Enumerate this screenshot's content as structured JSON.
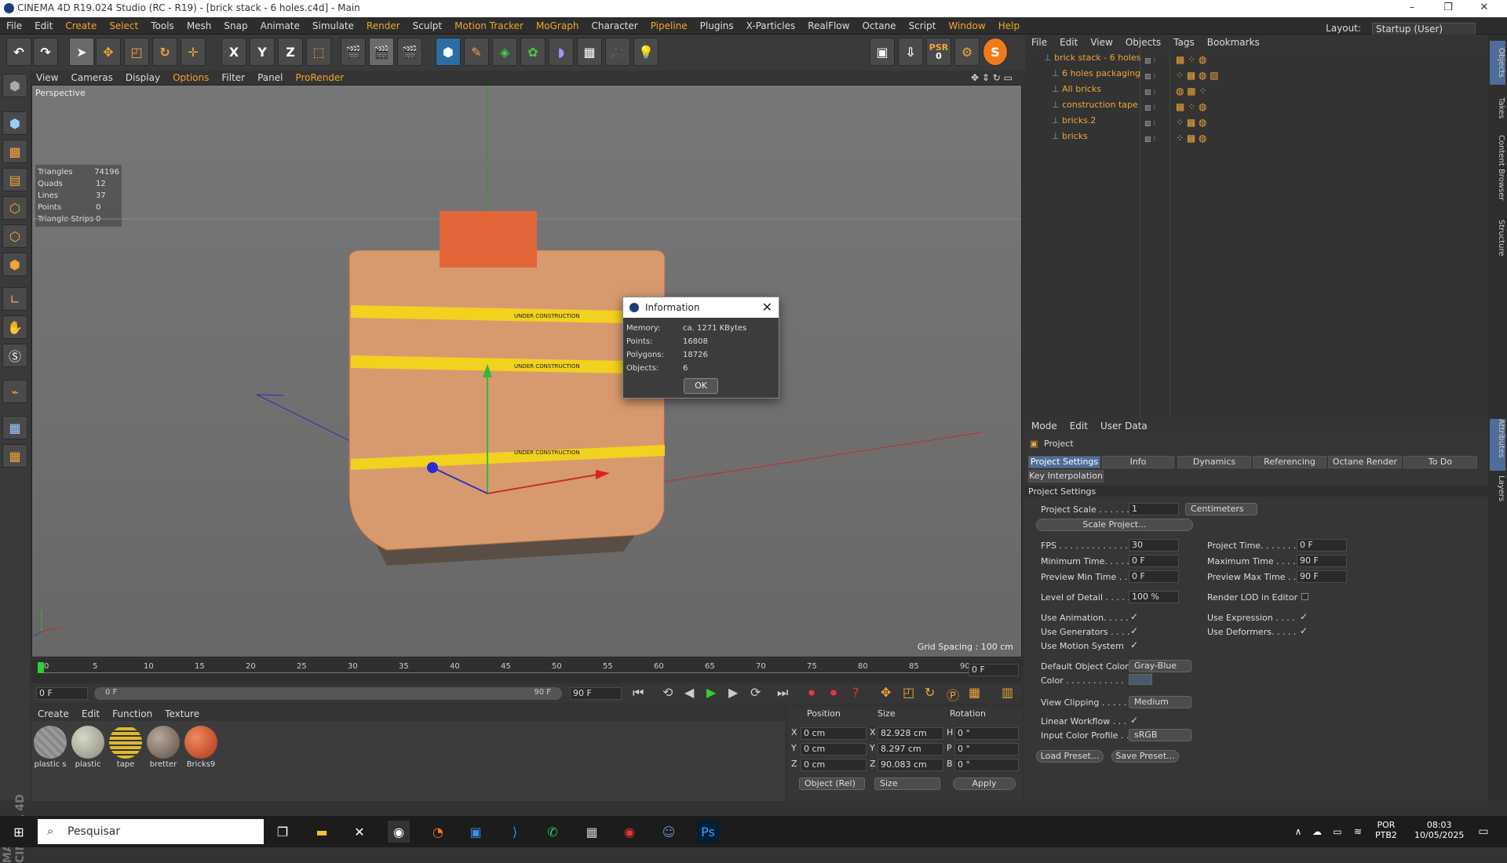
{
  "window": {
    "title": "CINEMA 4D R19.024 Studio (RC - R19) - [brick stack - 6 holes.c4d] - Main"
  },
  "menubar": {
    "items": [
      "File",
      "Edit",
      "Create",
      "Select",
      "Tools",
      "Mesh",
      "Snap",
      "Animate",
      "Simulate",
      "Render",
      "Sculpt",
      "Motion Tracker",
      "MoGraph",
      "Character",
      "Pipeline",
      "Plugins",
      "X-Particles",
      "RealFlow",
      "Octane",
      "Script",
      "Window",
      "Help"
    ],
    "layout_label": "Layout:",
    "layout_value": "Startup (User)"
  },
  "toolbar": {
    "psr_label": "PSR",
    "psr_value": "0",
    "axes": [
      "X",
      "Y",
      "Z"
    ]
  },
  "viewport": {
    "menu": [
      "View",
      "Cameras",
      "Display",
      "Options",
      "Filter",
      "Panel",
      "ProRender"
    ],
    "perspective": "Perspective",
    "stats": [
      {
        "k": "Triangles",
        "v": "74196"
      },
      {
        "k": "Quads",
        "v": "12"
      },
      {
        "k": "Lines",
        "v": "37"
      },
      {
        "k": "Points",
        "v": "0"
      },
      {
        "k": "Triangle Strips",
        "v": "0"
      }
    ],
    "grid_spacing": "Grid Spacing : 100 cm",
    "tape_text": "UNDER CONSTRUCTION"
  },
  "timeline": {
    "ticks": [
      "0",
      "5",
      "10",
      "15",
      "20",
      "25",
      "30",
      "35",
      "40",
      "45",
      "50",
      "55",
      "60",
      "65",
      "70",
      "75",
      "80",
      "85",
      "90"
    ],
    "current": "0 F",
    "start": "0 F",
    "range_start": "0 F",
    "range_end": "90 F",
    "end": "90 F"
  },
  "materials": {
    "menu": [
      "Create",
      "Edit",
      "Function",
      "Texture"
    ],
    "items": [
      {
        "name": "plastic s",
        "color": "#9a9a9a"
      },
      {
        "name": "plastic",
        "color": "#b7b7a7"
      },
      {
        "name": "tape",
        "color": "#e0b82a"
      },
      {
        "name": "bretter",
        "color": "#8e7f74"
      },
      {
        "name": "Bricks9",
        "color": "#d9542c"
      }
    ]
  },
  "coords": {
    "headers": [
      "Position",
      "Size",
      "Rotation"
    ],
    "rows": [
      {
        "a": "X",
        "p": "0 cm",
        "b": "X",
        "s": "82.928 cm",
        "c": "H",
        "r": "0 °"
      },
      {
        "a": "Y",
        "p": "0 cm",
        "b": "Y",
        "s": "8.297 cm",
        "c": "P",
        "r": "0 °"
      },
      {
        "a": "Z",
        "p": "0 cm",
        "b": "Z",
        "s": "90.083 cm",
        "c": "B",
        "r": "0 °"
      }
    ],
    "mode": "Object (Rel)",
    "size_mode": "Size",
    "apply": "Apply"
  },
  "objects": {
    "menu": [
      "File",
      "Edit",
      "View",
      "Objects",
      "Tags",
      "Bookmarks"
    ],
    "items": [
      "brick stack - 6 holes",
      "6 holes packaging",
      "All bricks",
      "construction tape",
      "bricks.2",
      "bricks"
    ]
  },
  "attributes": {
    "menu": [
      "Mode",
      "Edit",
      "User Data"
    ],
    "header": "Project",
    "tabs": [
      "Project Settings",
      "Info",
      "Dynamics",
      "Referencing",
      "Octane Render",
      "To Do"
    ],
    "tab2": "Key Interpolation",
    "section": "Project Settings",
    "project_scale_label": "Project Scale . . . . . .",
    "project_scale": "1",
    "scale_unit": "Centimeters",
    "scale_project": "Scale Project...",
    "fps_label": "FPS . . . . . . . . . . . . . .",
    "fps": "30",
    "project_time_label": "Project Time. . . . . . .",
    "project_time": "0 F",
    "min_time_label": "Minimum Time. . . . .",
    "min_time": "0 F",
    "max_time_label": "Maximum Time . . . .",
    "max_time": "90 F",
    "preview_min_label": "Preview Min Time . .",
    "preview_min": "0 F",
    "preview_max_label": "Preview Max Time . .",
    "preview_max": "90 F",
    "lod_label": "Level of Detail . . . . .",
    "lod": "100 %",
    "render_lod_label": "Render LOD in Editor",
    "use_animation": "Use Animation. . . . .",
    "use_expression": "Use Expression . . . .",
    "use_generators": "Use Generators . . . .",
    "use_deformers": "Use Deformers. . . . .",
    "use_motion": "Use Motion System",
    "default_color_label": "Default Object Color",
    "default_color": "Gray-Blue",
    "color_label": "Color . . . . . . . . . . .",
    "view_clipping_label": "View Clipping . . . . .",
    "view_clipping": "Medium",
    "linear_workflow": "Linear Workflow . . .",
    "input_color_label": "Input Color Profile . .",
    "input_color": "sRGB",
    "load_preset": "Load Preset...",
    "save_preset": "Save Preset...",
    "check": "✓"
  },
  "right_tabs": [
    "Objects",
    "Takes",
    "Content Browser",
    "Structure"
  ],
  "right_tabs2": [
    "Attributes",
    "Layers"
  ],
  "dialog": {
    "title": "Information",
    "rows": [
      {
        "k": "Memory:",
        "v": "ca. 1271 KBytes"
      },
      {
        "k": "Points:",
        "v": "16808"
      },
      {
        "k": "Polygons:",
        "v": "18726"
      },
      {
        "k": "Objects:",
        "v": "6"
      }
    ],
    "ok": "OK"
  },
  "taskbar": {
    "search": "Pesquisar",
    "lang": "POR",
    "lang2": "PTB2",
    "time": "08:03",
    "date": "10/05/2025"
  },
  "colors": {
    "accent": "#f1a53a",
    "tab_active": "#4e6e9a"
  }
}
